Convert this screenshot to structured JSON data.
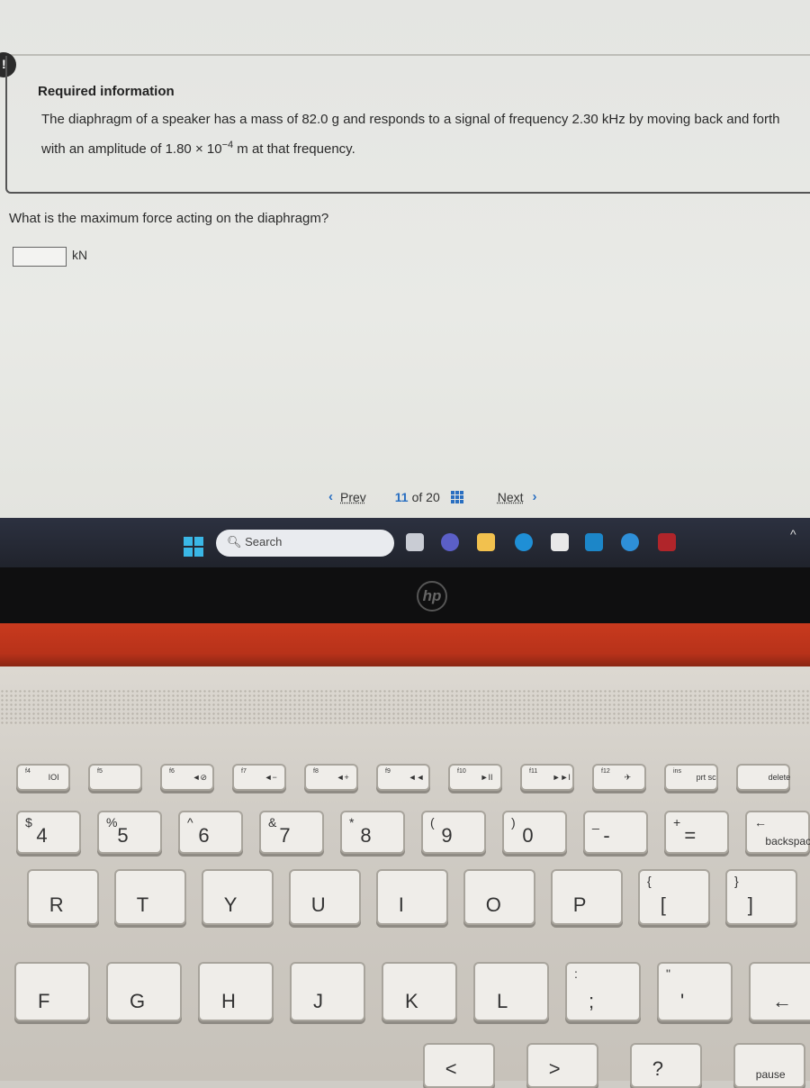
{
  "alert_icon": "!",
  "required_info": {
    "title": "Required information",
    "text_before": "The diaphragm of a speaker has a mass of 82.0 g and responds to a signal of frequency 2.30 kHz by moving back and forth with an amplitude of 1.80 × 10",
    "exponent": "−4",
    "text_after": " m at that frequency."
  },
  "question": {
    "text": "What is the maximum force acting on the diaphragm?",
    "answer_value": "",
    "unit": "kN"
  },
  "pager": {
    "prev": "Prev",
    "current": "11",
    "of": "of 20",
    "next": "Next"
  },
  "taskbar": {
    "search_placeholder": "Search",
    "icons": [
      "windows-start-icon",
      "task-view-icon",
      "meet-icon",
      "file-explorer-icon",
      "edge-icon",
      "store-icon",
      "mcafee-app-icon",
      "help-icon",
      "mcafee-icon"
    ]
  },
  "brand_logo": "hp",
  "colors": {
    "accent": "#2a6fc1",
    "taskbar": "#262a35",
    "laptop_red": "#c03620"
  },
  "keyboard": {
    "function_row": [
      {
        "fn": "f4",
        "label": "IOI"
      },
      {
        "fn": "f5",
        "label": ""
      },
      {
        "fn": "f6",
        "label": "◄⊘"
      },
      {
        "fn": "f7",
        "label": "◄−"
      },
      {
        "fn": "f8",
        "label": "◄+"
      },
      {
        "fn": "f9",
        "label": "◄◄"
      },
      {
        "fn": "f10",
        "label": "►II"
      },
      {
        "fn": "f11",
        "label": "►►I"
      },
      {
        "fn": "f12",
        "label": "✈"
      },
      {
        "fn": "ins",
        "label": "prt sc"
      },
      {
        "fn": "",
        "label": "delete"
      }
    ],
    "number_row": [
      {
        "top": "$",
        "main": "4"
      },
      {
        "top": "%",
        "main": "5"
      },
      {
        "top": "^",
        "main": "6"
      },
      {
        "top": "&",
        "main": "7"
      },
      {
        "top": "*",
        "main": "8"
      },
      {
        "top": "(",
        "main": "9"
      },
      {
        "top": ")",
        "main": "0"
      },
      {
        "top": "_",
        "main": "-"
      },
      {
        "top": "+",
        "main": "="
      },
      {
        "top": "←",
        "main": "backspace"
      }
    ],
    "letter_row": [
      {
        "top": "",
        "main": "R"
      },
      {
        "top": "",
        "main": "T"
      },
      {
        "top": "",
        "main": "Y"
      },
      {
        "top": "",
        "main": "U"
      },
      {
        "top": "",
        "main": "I"
      },
      {
        "top": "",
        "main": "O"
      },
      {
        "top": "",
        "main": "P"
      },
      {
        "top": "{",
        "main": "["
      },
      {
        "top": "}",
        "main": "]"
      }
    ],
    "home_row": [
      {
        "top": "",
        "main": "F"
      },
      {
        "top": "",
        "main": "G"
      },
      {
        "top": "",
        "main": "H"
      },
      {
        "top": "",
        "main": "J"
      },
      {
        "top": "",
        "main": "K"
      },
      {
        "top": "",
        "main": "L"
      },
      {
        "top": ":",
        "main": ";"
      },
      {
        "top": "\"",
        "main": "'"
      },
      {
        "top": "",
        "main": "←"
      }
    ],
    "bottom_row": [
      {
        "top": "",
        "main": "<"
      },
      {
        "top": "",
        "main": ">"
      },
      {
        "top": "",
        "main": "?"
      },
      {
        "top": "",
        "main": "pause"
      }
    ]
  }
}
